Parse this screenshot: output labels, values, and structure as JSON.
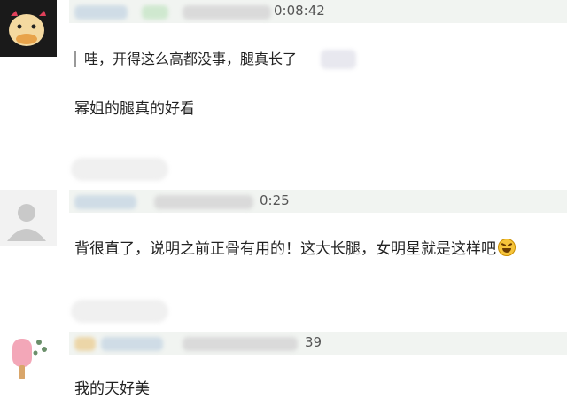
{
  "comments": [
    {
      "time_suffix": "0:08:42",
      "quote": "哇，开得这么高都没事，腿真长了",
      "text": "幂姐的腿真的好看"
    },
    {
      "time_suffix": "0:25",
      "text": "背很直了，说明之前正骨有用的！这大长腿，女明星就是这样吧"
    },
    {
      "time_suffix": "39",
      "text": "我的天好美"
    }
  ],
  "icons": {
    "avatar1": "duck-avatar-icon",
    "avatar2": "default-user-icon",
    "avatar3": "popsicle-avatar-icon",
    "emoji": "grinning-squint-emoji-icon"
  },
  "colors": {
    "meta_bar": "#f1f4f1",
    "text": "#222222"
  }
}
